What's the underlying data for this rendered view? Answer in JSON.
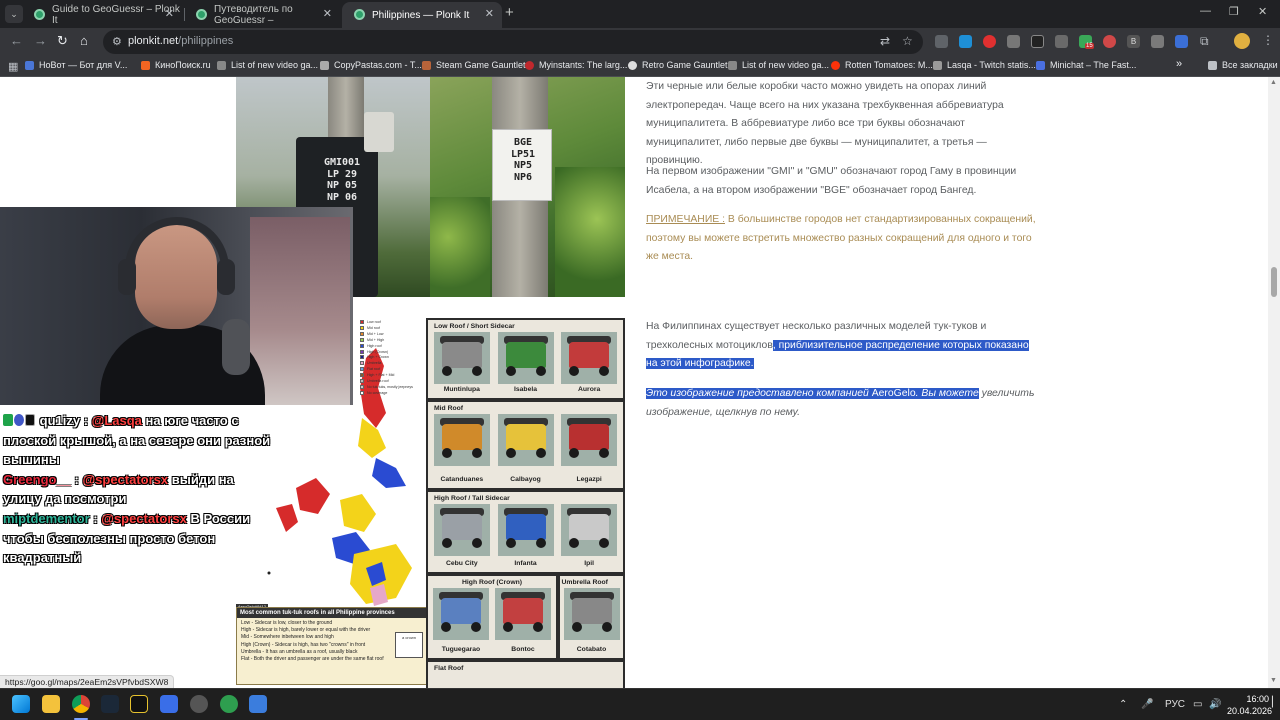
{
  "browser": {
    "tabs": [
      {
        "title": "Guide to GeoGuessr – Plonk It",
        "active": false
      },
      {
        "title": "Путеводитель по GeoGuessr –",
        "active": false
      },
      {
        "title": "Philippines — Plonk It",
        "active": true
      }
    ],
    "new_tab_label": "+",
    "url_host": "plonkit.net",
    "url_path": "/philippines",
    "extension_badge": "15",
    "extension_letter": "B",
    "bookmarks": [
      "НоВот — Бот для V...",
      "КиноПоиск.ru",
      "List of new video ga...",
      "CopyPastas.com - T...",
      "Steam Game Gauntlet",
      "Myinstants: The larg...",
      "Retro Game Gauntlet",
      "List of new video ga...",
      "Rotten Tomatoes: M...",
      "Lasqa - Twitch statis...",
      "Minichat – The Fast..."
    ],
    "bookmarks_more": "»",
    "all_bookmarks": "Все закладки"
  },
  "article": {
    "p1": "Эти черные или белые коробки часто можно увидеть на опорах линий электропередач. Чаще всего на них указана трехбуквенная аббревиатура муниципалитета. В аббревиатуре либо все три буквы обозначают муниципалитет, либо первые две буквы — муниципалитет, а третья — провинцию.",
    "p2": "На первом изображении \"GMI\" и \"GMU\" обозначают город Гаму в провинции Исабела, а на втором изображении \"BGE\" обозначает город Бангед.",
    "note_label": "ПРИМЕЧАНИЕ :",
    "note_text": " В большинстве городов нет стандартизированных сокращений, поэтому вы можете встретить множество разных сокращений для одного и того же места.",
    "p3_plain": "На Филиппинах существует несколько различных моделей тук-туков и трехколесных мотоциклов",
    "p3_highlight": ", приблизительное распределение которых показано на этой инфографике.",
    "p4_highlight_a": "Это изображение предоставлено компанией ",
    "p4_company": "AeroGelo",
    "p4_highlight_b": ". Вы можете",
    "p4_rest": " увеличить изображение, щелкнув по нему."
  },
  "signs": {
    "left": [
      "GMI001",
      "LP 29",
      "NP 05",
      "NP 06"
    ],
    "right": [
      "BGE",
      "LP51",
      "NP5",
      "NP6"
    ]
  },
  "infographic": {
    "legend": [
      "Low roof",
      "Mid roof",
      "Mid + Low",
      "Mid + High",
      "High roof",
      "High (Crown)",
      "High + Crown",
      "Umbrella",
      "Flat roof",
      "High + Flat + Mid",
      "Umbrella roof",
      "No tuk-tuks, mostly jeepneys",
      "No coverage"
    ],
    "legend_colors": [
      "#d62b2b",
      "#f3d31a",
      "#e88a2a",
      "#9bd24a",
      "#2a4bd2",
      "#7a3ab8",
      "#1d1d8a",
      "#e6a8c8",
      "#6aa0e0",
      "#8b5a2b",
      "#bbbbbb",
      "#cccccc",
      "#ffffff"
    ],
    "tag": "AeroGelo#9412",
    "box_title": "Most common tuk-tuk roofs in all Philippine provinces",
    "box_lines": [
      "Low - Sidecar is low, closer to the ground",
      "High - Sidecar is high, barely lower or equal with the driver",
      "Mid - Somewhere inbetween low and high",
      "High (Crown) - Sidecar is high, has two \"crowns\" in front",
      "Umbrella - It has an umbrella as a roof, usually black",
      "Flat - Both the driver and passenger are under the same flat roof"
    ],
    "crown_label": "a crown",
    "categories": [
      {
        "title": "Low Roof / Short Sidecar",
        "items": [
          "Muntinlupa",
          "Isabela",
          "Aurora"
        ]
      },
      {
        "title": "Mid Roof",
        "items": [
          "Catanduanes",
          "Calbayog",
          "Legazpi"
        ]
      },
      {
        "title": "High Roof / Tall Sidecar",
        "items": [
          "Cebu City",
          "Infanta",
          "Ipil"
        ]
      },
      {
        "title": "High Roof (Crown)",
        "items": [
          "Tuguegarao",
          "Bontoc"
        ]
      },
      {
        "title": "Umbrella Roof",
        "items": [
          "Cotabato"
        ]
      },
      {
        "title": "Flat Roof",
        "items": []
      }
    ]
  },
  "chat": [
    {
      "user": "qu1izy",
      "sep": " : ",
      "mention": "@Lasqa",
      "text": " на юге часто с плоской крышой, а на севере они разной вышины"
    },
    {
      "user": "Greengo__",
      "sep": " : ",
      "mention": "@spectatorsx",
      "text": " выйди на улицу да посмотри"
    },
    {
      "user": "miptdementor",
      "sep": " : ",
      "mention": "@spectatorsx",
      "text": " В России чтобы бесполезны просто бетон квадратный"
    }
  ],
  "status_url": "https://goo.gl/maps/2eaEm2sVPfvbdSXW8",
  "taskbar": {
    "language": "РУС",
    "time": "16:00",
    "date": "20.04.2026"
  }
}
